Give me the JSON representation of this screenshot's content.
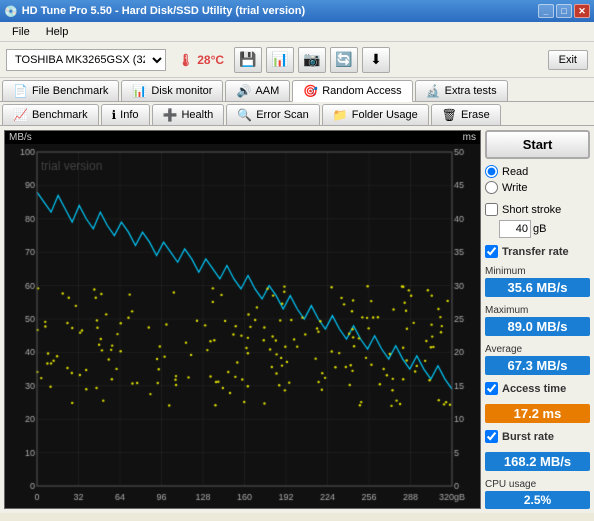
{
  "titlebar": {
    "title": "HD Tune Pro 5.50 - Hard Disk/SSD Utility (trial version)",
    "icon": "💾"
  },
  "menubar": {
    "items": [
      "File",
      "Help"
    ]
  },
  "toolbar": {
    "drive": "TOSHIBA MK3265GSX (320 gB)",
    "temperature": "28°C",
    "exit_label": "Exit"
  },
  "tabs_row1": [
    {
      "label": "File Benchmark",
      "icon": "📄"
    },
    {
      "label": "Disk monitor",
      "icon": "📊"
    },
    {
      "label": "AAM",
      "icon": "🔊"
    },
    {
      "label": "Random Access",
      "icon": "🎯",
      "active": true
    },
    {
      "label": "Extra tests",
      "icon": "🔬"
    }
  ],
  "tabs_row2": [
    {
      "label": "Benchmark",
      "icon": "📈"
    },
    {
      "label": "Info",
      "icon": "ℹ"
    },
    {
      "label": "Health",
      "icon": "➕"
    },
    {
      "label": "Error Scan",
      "icon": "🔍"
    },
    {
      "label": "Folder Usage",
      "icon": "📁"
    },
    {
      "label": "Erase",
      "icon": "🗑"
    }
  ],
  "chart": {
    "mb_label": "MB/s",
    "ms_label": "ms",
    "watermark": "trial version",
    "x_labels": [
      "0",
      "32",
      "64",
      "96",
      "128",
      "160",
      "192",
      "224",
      "256",
      "288",
      "320gB"
    ],
    "y_left_labels": [
      "100",
      "90",
      "80",
      "70",
      "60",
      "50",
      "40",
      "30",
      "20",
      "10",
      "0"
    ],
    "y_right_labels": [
      "50",
      "45",
      "40",
      "35",
      "30",
      "25",
      "20",
      "15",
      "10",
      "5",
      "0"
    ]
  },
  "controls": {
    "start_label": "Start",
    "read_label": "Read",
    "write_label": "Write",
    "short_stroke_label": "Short stroke",
    "short_stroke_value": "40",
    "short_stroke_unit": "gB",
    "transfer_rate_label": "Transfer rate",
    "minimum_label": "Minimum",
    "minimum_value": "35.6 MB/s",
    "maximum_label": "Maximum",
    "maximum_value": "89.0 MB/s",
    "average_label": "Average",
    "average_value": "67.3 MB/s",
    "access_time_label": "Access time",
    "access_time_value": "17.2 ms",
    "burst_rate_label": "Burst rate",
    "burst_rate_value": "168.2 MB/s",
    "cpu_usage_label": "CPU usage",
    "cpu_usage_value": "2.5%"
  }
}
